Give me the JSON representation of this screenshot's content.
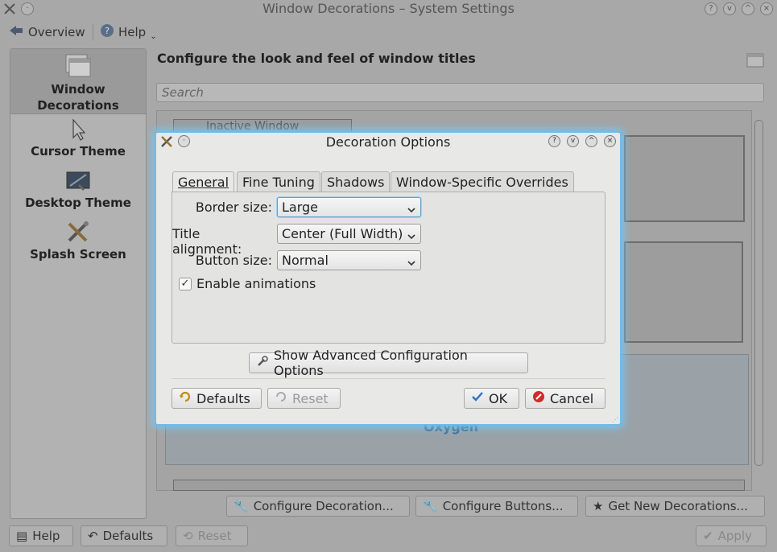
{
  "window": {
    "title": "Window Decorations – System Settings"
  },
  "toolbar": {
    "overview_label": "Overview",
    "help_label": "Help"
  },
  "sidebar": {
    "items": [
      {
        "label_line1": "Window",
        "label_line2": "Decorations",
        "icon": "window-decorations-icon"
      },
      {
        "label_line1": "Cursor Theme",
        "icon": "cursor-icon"
      },
      {
        "label_line1": "Desktop Theme",
        "icon": "desktop-theme-icon"
      },
      {
        "label_line1": "Splash Screen",
        "icon": "splash-screen-icon"
      }
    ]
  },
  "content": {
    "heading": "Configure the look and feel of window titles",
    "search_placeholder": "Search",
    "preview_theme_name": "Oxygen",
    "preview_inactive_title": "Inactive Window",
    "configure_decoration_label": "Configure Decoration...",
    "configure_buttons_label": "Configure Buttons...",
    "get_new_label": "Get New Decorations..."
  },
  "footer": {
    "help_label": "Help",
    "defaults_label": "Defaults",
    "reset_label": "Reset",
    "apply_label": "Apply"
  },
  "dialog": {
    "title": "Decoration Options",
    "tabs": [
      "General",
      "Fine Tuning",
      "Shadows",
      "Window-Specific Overrides"
    ],
    "active_tab": "General",
    "border_size_label": "Border size:",
    "border_size_value": "Large",
    "title_alignment_label": "Title alignment:",
    "title_alignment_value": "Center (Full Width)",
    "button_size_label": "Button size:",
    "button_size_value": "Normal",
    "enable_animations_label": "Enable animations",
    "enable_animations_checked": true,
    "advanced_button_label": "Show Advanced Configuration Options",
    "defaults_label": "Defaults",
    "reset_label": "Reset",
    "ok_label": "OK",
    "cancel_label": "Cancel"
  },
  "colors": {
    "focus_glow": "#6dbde8",
    "cancel_red": "#d42a2a",
    "ok_blue": "#2c72c7"
  }
}
